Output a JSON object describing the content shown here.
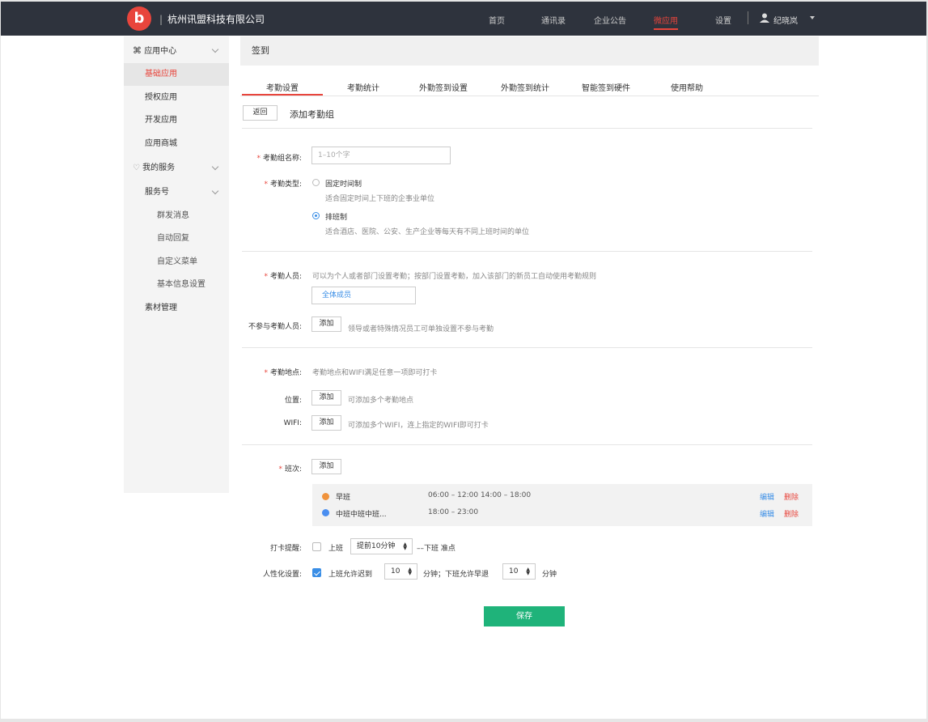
{
  "header": {
    "logo_letter": "b",
    "company": "杭州讯盟科技有限公司",
    "nav": [
      "首页",
      "通讯录",
      "企业公告",
      "微应用",
      "设置"
    ],
    "active_nav": "微应用",
    "user": "纪晓岚"
  },
  "sidebar": {
    "section1": "应用中心",
    "items1": [
      "基础应用",
      "授权应用",
      "开发应用",
      "应用商城"
    ],
    "section2": "我的服务",
    "sub_section": "服务号",
    "sub_items": [
      "群发消息",
      "自动回复",
      "自定义菜单",
      "基本信息设置"
    ],
    "material": "素材管理"
  },
  "breadcrumb": "签到",
  "tabs": [
    "考勤设置",
    "考勤统计",
    "外勤签到设置",
    "外勤签到统计",
    "智能签到硬件",
    "使用帮助"
  ],
  "form": {
    "back": "返回",
    "title": "添加考勤组",
    "name_label": "考勤组名称:",
    "name_placeholder": "1–10个字",
    "type_label": "考勤类型:",
    "type_fixed": "固定时间制",
    "type_fixed_desc": "适合固定时间上下班的企事业单位",
    "type_shift": "排班制",
    "type_shift_desc": "适合酒店、医院、公安、生产企业等每天有不同上班时间的单位",
    "members_label": "考勤人员:",
    "members_hint": "可以为个人或者部门设置考勤；按部门设置考勤，加入该部门的新员工自动使用考勤规则",
    "members_value": "全体成员",
    "exclude_label": "不参与考勤人员:",
    "add": "添加",
    "exclude_hint": "领导或者特殊情况员工可单独设置不参与考勤",
    "location_label": "考勤地点:",
    "location_hint": "考勤地点和WIFI满足任意一项即可打卡",
    "position_label": "位置:",
    "position_hint": "可添加多个考勤地点",
    "wifi_label": "WIFI:",
    "wifi_hint": "可添加多个WIFI，连上指定的WIFI即可打卡",
    "shift_label": "班次:",
    "shifts": [
      {
        "name": "早班",
        "time": "06:00 – 12:00  14:00 – 18:00",
        "color": "#f0933c"
      },
      {
        "name": "中班中班中班...",
        "time": "18:00 – 23:00",
        "color": "#4a8ef0"
      }
    ],
    "edit": "编辑",
    "delete": "删除",
    "remind_label": "打卡提醒:",
    "remind_on": "上班",
    "remind_select": "提前10分钟",
    "remind_off": "––下班 准点",
    "human_label": "人性化设置:",
    "late_text": "上班允许迟到",
    "late_value": "10",
    "mid_text": "分钟；下班允许早退",
    "early_value": "10",
    "minute": "分钟",
    "save": "保存"
  }
}
